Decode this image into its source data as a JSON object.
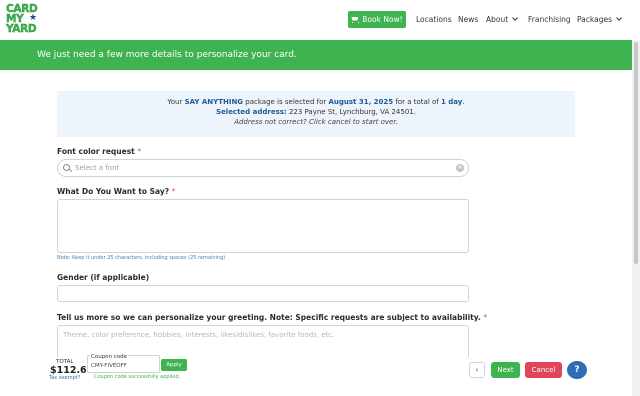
{
  "logo": {
    "line1": "CARD",
    "line2": "MY",
    "line3": "YARD",
    "star": "★"
  },
  "nav": {
    "book_now": "Book Now!",
    "locations": "Locations",
    "news": "News",
    "about": "About",
    "franchising": "Franchising",
    "packages": "Packages"
  },
  "banner": {
    "text": "We just need a few more details to personalize your card."
  },
  "info": {
    "line1_prefix": "Your ",
    "package": "SAY ANYTHING",
    "line1_mid": " package is selected for ",
    "date": "August 31, 2025",
    "line1_mid2": " for a total of ",
    "days": "1 day",
    "line1_end": ".",
    "address_label": "Selected address:",
    "address": " 223 Payne St, Lynchburg, VA 24501.",
    "address_note": "Address not correct? Click cancel to start over."
  },
  "form": {
    "font_label": "Font color request",
    "font_placeholder": "Select a font",
    "say_label": "What Do You Want to Say?",
    "say_note": "Note: Keep it under 25 characters, including spaces (25 remaining)",
    "gender_label": "Gender (if applicable)",
    "tell_label": "Tell us more so we can personalize your greeting. Note: Specific requests are subject to availability.",
    "tell_placeholder": "Theme, color preference, hobbies, interests, likes/dislikes, favorite foods, etc.",
    "required_mark": "*"
  },
  "footer": {
    "total_label": "TOTAL",
    "total_value": "$112.67",
    "tax_link": "Tax exempt?",
    "coupon_label": "Coupon code",
    "coupon_value": "CMY-FIVEOFF",
    "apply": "Apply",
    "coupon_success": "Coupon code successfully applied.",
    "back": "‹",
    "next": "Next",
    "cancel": "Cancel",
    "help": "?"
  },
  "colors": {
    "brand_green": "#3fb34f",
    "accent_blue": "#1d5a99",
    "cancel_red": "#e0455a"
  }
}
